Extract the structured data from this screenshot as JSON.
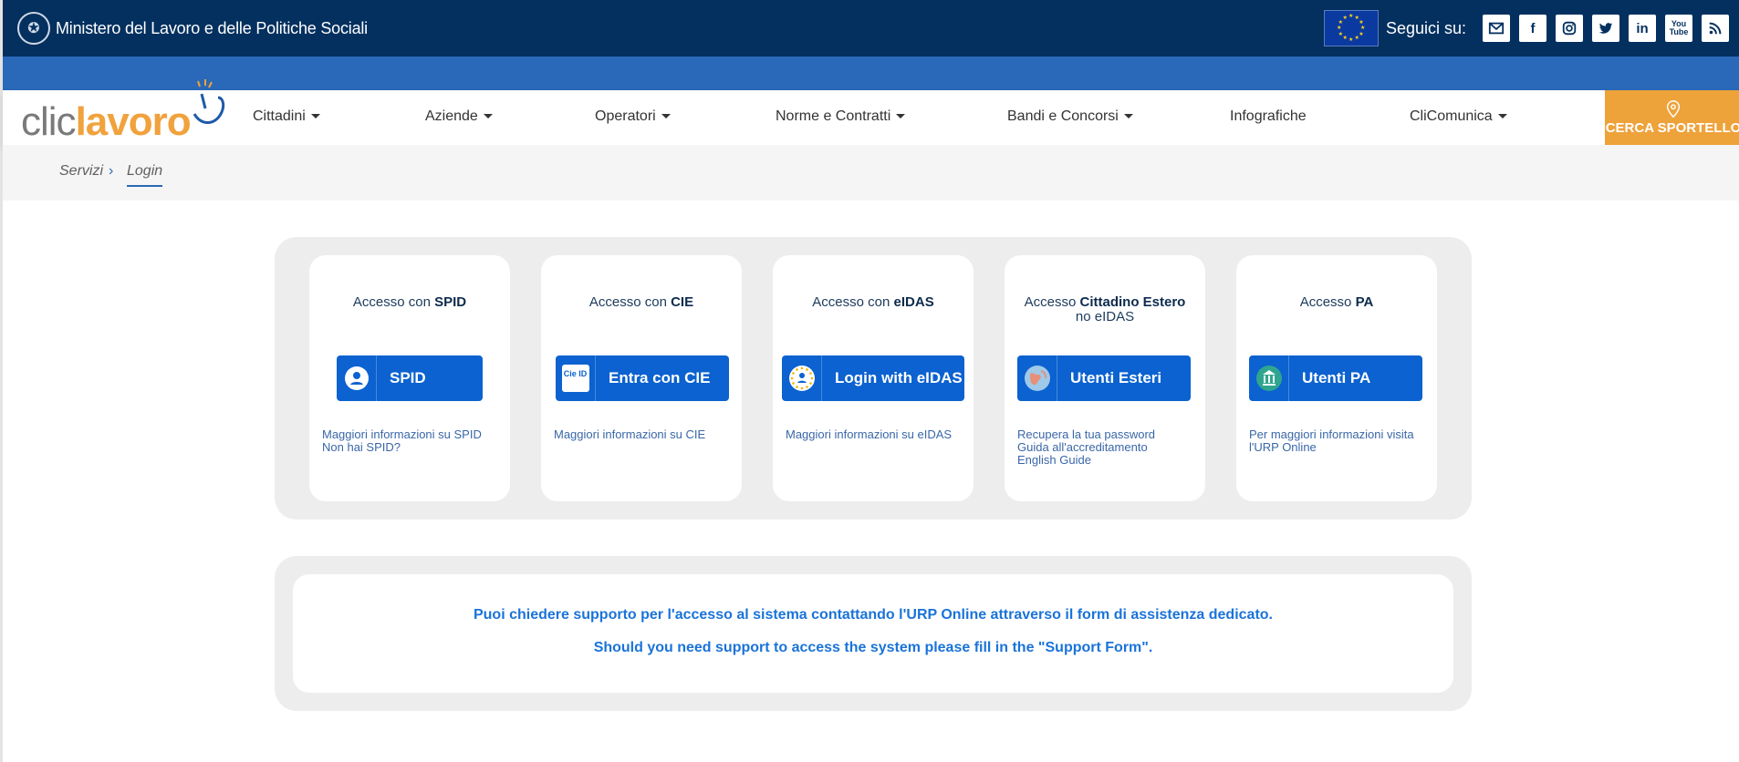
{
  "topbar": {
    "ministry": "Ministero del Lavoro e delle Politiche Sociali",
    "follow_label": "Seguici su:",
    "socials": [
      "mail-icon",
      "facebook-icon",
      "instagram-icon",
      "twitter-icon",
      "linkedin-icon",
      "youtube-icon",
      "rss-icon"
    ]
  },
  "logo": {
    "part1": "clic",
    "part2": "lavoro"
  },
  "nav": {
    "items": [
      "Cittadini",
      "Aziende",
      "Operatori",
      "Norme e Contratti",
      "Bandi e Concorsi",
      "Infografiche",
      "CliComunica"
    ],
    "cta": "CERCA SPORTELLO"
  },
  "breadcrumb": {
    "item1": "Servizi",
    "separator": "›",
    "item2": "Login"
  },
  "cards": [
    {
      "title_prefix": "Accesso con ",
      "title_bold": "SPID",
      "title_line2": "",
      "button": "SPID",
      "links": [
        "Maggiori informazioni su SPID",
        "Non hai SPID?"
      ]
    },
    {
      "title_prefix": "Accesso con ",
      "title_bold": "CIE",
      "title_line2": "",
      "button": "Entra con CIE",
      "icon_text": "Cie ID",
      "links": [
        "Maggiori informazioni su CIE"
      ]
    },
    {
      "title_prefix": "Accesso con ",
      "title_bold": "eIDAS",
      "title_line2": "",
      "button": "Login with eIDAS",
      "links": [
        "Maggiori informazioni su eIDAS"
      ]
    },
    {
      "title_prefix": "Accesso ",
      "title_bold": "Cittadino Estero",
      "title_line2": "no eIDAS",
      "button": "Utenti Esteri",
      "links": [
        "Recupera la tua password",
        "Guida all'accreditamento",
        "English Guide"
      ]
    },
    {
      "title_prefix": "Accesso ",
      "title_bold": "PA",
      "title_line2": "",
      "button": "Utenti PA",
      "links": [
        "Per maggiori informazioni visita",
        "l'URP Online"
      ]
    }
  ],
  "support": {
    "line1": "Puoi chiedere supporto per l'accesso al sistema contattando l'URP Online attraverso il form di assistenza dedicato.",
    "line2": "Should you need support to access the system please fill in the \"Support Form\"."
  },
  "colors": {
    "topbar": "#03305f",
    "bluebar": "#2a69b9",
    "button": "#0b62d0",
    "cta": "#eea23a",
    "support_text": "#1a73d9"
  }
}
